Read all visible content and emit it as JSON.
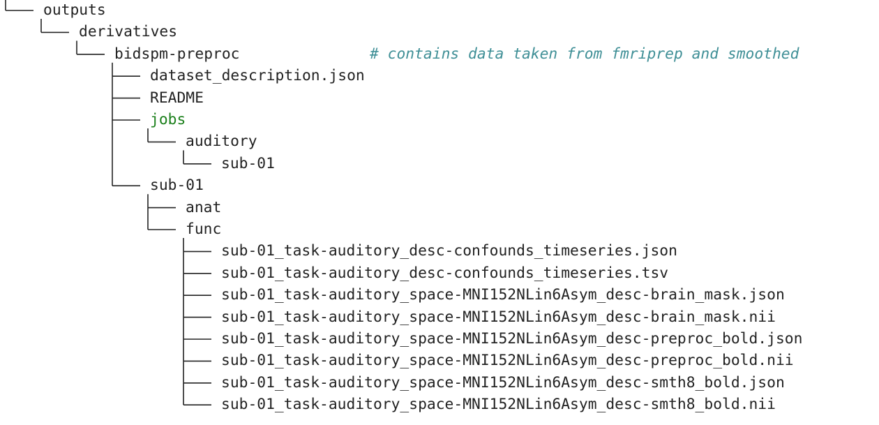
{
  "tree": {
    "nodes": [
      {
        "name": "outputs",
        "depth": 0,
        "last": true
      },
      {
        "name": "derivatives",
        "depth": 1,
        "last": true
      },
      {
        "name": "bidspm-preproc",
        "depth": 2,
        "last": true,
        "comment": "# contains data taken from fmriprep and smoothed"
      },
      {
        "name": "dataset_description.json",
        "depth": 3,
        "last": false
      },
      {
        "name": "README",
        "depth": 3,
        "last": false
      },
      {
        "name": "jobs",
        "depth": 3,
        "last": false,
        "highlight": true
      },
      {
        "name": "auditory",
        "depth": 4,
        "last": true
      },
      {
        "name": "sub-01",
        "depth": 5,
        "last": true
      },
      {
        "name": "sub-01",
        "depth": 3,
        "last": true
      },
      {
        "name": "anat",
        "depth": 4,
        "last": false
      },
      {
        "name": "func",
        "depth": 4,
        "last": true
      },
      {
        "name": "sub-01_task-auditory_desc-confounds_timeseries.json",
        "depth": 5,
        "last": false
      },
      {
        "name": "sub-01_task-auditory_desc-confounds_timeseries.tsv",
        "depth": 5,
        "last": false
      },
      {
        "name": "sub-01_task-auditory_space-MNI152NLin6Asym_desc-brain_mask.json",
        "depth": 5,
        "last": false
      },
      {
        "name": "sub-01_task-auditory_space-MNI152NLin6Asym_desc-brain_mask.nii",
        "depth": 5,
        "last": false
      },
      {
        "name": "sub-01_task-auditory_space-MNI152NLin6Asym_desc-preproc_bold.json",
        "depth": 5,
        "last": false
      },
      {
        "name": "sub-01_task-auditory_space-MNI152NLin6Asym_desc-preproc_bold.nii",
        "depth": 5,
        "last": false
      },
      {
        "name": "sub-01_task-auditory_space-MNI152NLin6Asym_desc-smth8_bold.json",
        "depth": 5,
        "last": false
      },
      {
        "name": "sub-01_task-auditory_space-MNI152NLin6Asym_desc-smth8_bold.nii",
        "depth": 5,
        "last": true
      }
    ],
    "colors": {
      "text": "#222222",
      "highlight": "#1a7f1a",
      "comment": "#3f8f96",
      "line": "#222222"
    }
  }
}
